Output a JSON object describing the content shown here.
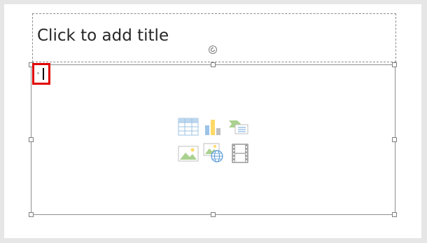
{
  "slide": {
    "title_placeholder": "Click to add title"
  },
  "content_placeholder": {
    "insert_icons": [
      "insert-table-icon",
      "insert-chart-icon",
      "insert-smartart-icon",
      "insert-picture-icon",
      "insert-online-picture-icon",
      "insert-video-icon"
    ]
  },
  "colors": {
    "highlight": "#e00000",
    "icon_blue": "#5b9bd5",
    "icon_green": "#70ad47",
    "icon_gray": "#7f7f7f"
  }
}
